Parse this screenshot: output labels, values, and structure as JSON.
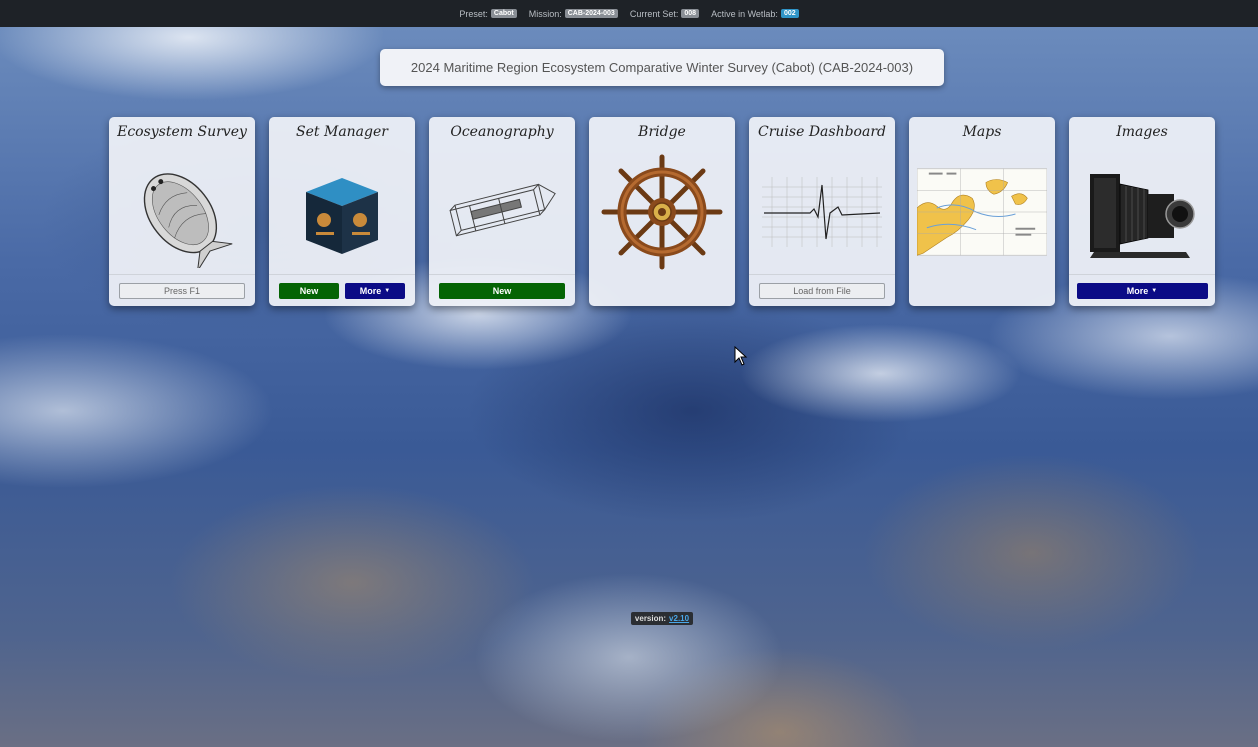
{
  "topbar": {
    "preset_label": "Preset:",
    "preset_value": "Cabot",
    "mission_label": "Mission:",
    "mission_value": "CAB-2024-003",
    "current_set_label": "Current Set:",
    "current_set_value": "008",
    "wetlab_label": "Active in Wetlab:",
    "wetlab_value": "002",
    "wetlab_badge_color": "#2f94c7"
  },
  "mission_title": "2024 Maritime Region Ecosystem Comparative Winter Survey (Cabot) (CAB-2024-003)",
  "cards": [
    {
      "title": "Ecosystem Survey",
      "icon": "flatfish-icon",
      "buttons": [
        "Press F1"
      ]
    },
    {
      "title": "Set Manager",
      "icon": "chalk-cube-icon",
      "buttons": [
        "New",
        "More"
      ]
    },
    {
      "title": "Oceanography",
      "icon": "ctd-instrument-icon",
      "buttons": [
        "New"
      ]
    },
    {
      "title": "Bridge",
      "icon": "ship-wheel-icon",
      "buttons": []
    },
    {
      "title": "Cruise Dashboard",
      "icon": "heartbeat-chart-icon",
      "buttons": [
        "Load from File"
      ]
    },
    {
      "title": "Maps",
      "icon": "nautical-chart-icon",
      "buttons": []
    },
    {
      "title": "Images",
      "icon": "vintage-camera-icon",
      "buttons": [
        "More"
      ]
    }
  ],
  "version": {
    "label": "version:",
    "value": "v2.10"
  },
  "colors": {
    "green_button": "#046404",
    "navy_button": "#0b0b86"
  }
}
